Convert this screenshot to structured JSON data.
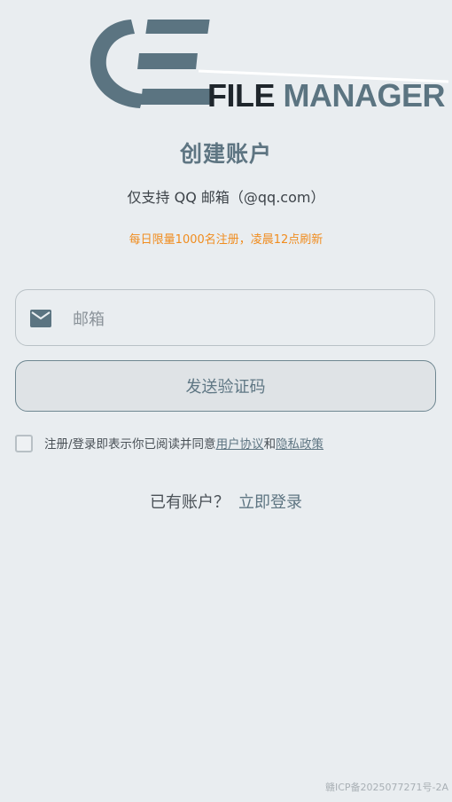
{
  "brand": {
    "word1": "FILE",
    "word2": "MANAGER"
  },
  "header": {
    "title": "创建账户",
    "subtitle": "仅支持 QQ 邮箱（@qq.com）",
    "notice": "每日限量1000名注册，凌晨12点刷新"
  },
  "form": {
    "email_placeholder": "邮箱",
    "email_value": "",
    "send_code_label": "发送验证码"
  },
  "agreement": {
    "checked": false,
    "text_prefix": "注册/登录即表示你已阅读并同意",
    "user_agreement": "用户协议",
    "conjunction": "和",
    "privacy_policy": "隐私政策"
  },
  "login": {
    "question": "已有账户？",
    "link": "立即登录"
  },
  "footer": {
    "icp": "赣ICP备2025077271号-2A"
  },
  "colors": {
    "background": "#e9edf0",
    "accent": "#5e7582",
    "notice": "#f08c1e"
  },
  "icons": {
    "email": "mail-icon",
    "logo": "file-manager-logo"
  }
}
